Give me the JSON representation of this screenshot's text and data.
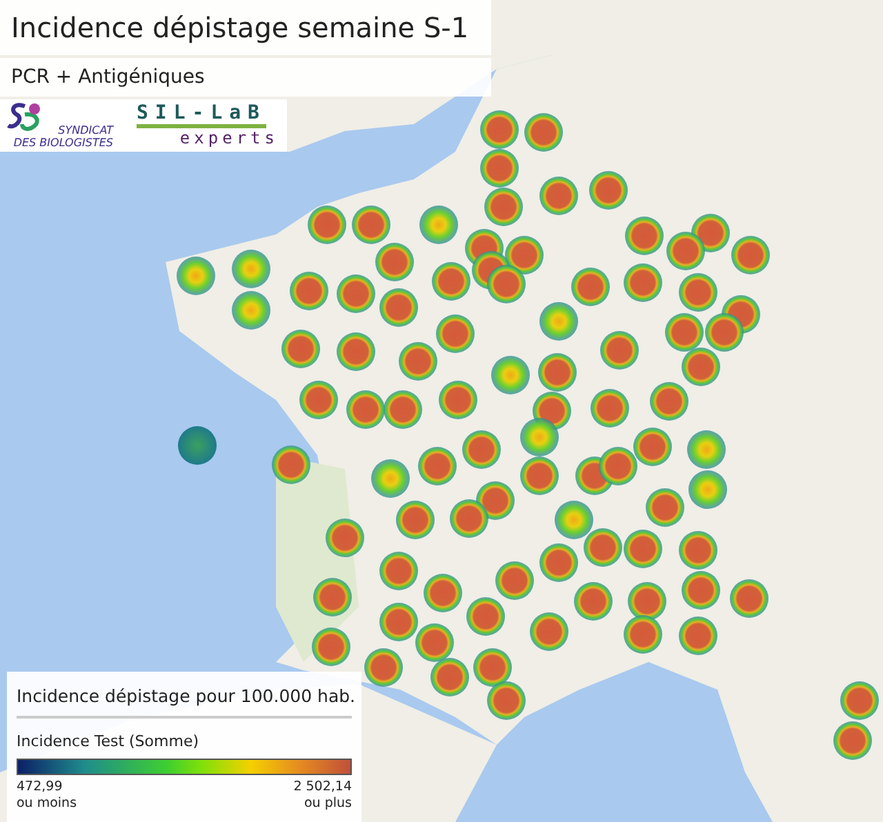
{
  "title": "Incidence dépistage semaine S-1",
  "subtitle": "PCR + Antigéniques",
  "logos": {
    "syndicat_line_1": "SYNDICAT",
    "syndicat_line_2": "DES BIOLOGISTES",
    "sillab_name": "SIL-LaB",
    "sillab_tagline": "experts"
  },
  "legend": {
    "title": "Incidence dépistage pour 100.000 hab.",
    "measure": "Incidence Test (Somme)",
    "min_value": "472,99",
    "min_note": "ou moins",
    "max_value": "2 502,14",
    "max_note": "ou plus"
  }
}
